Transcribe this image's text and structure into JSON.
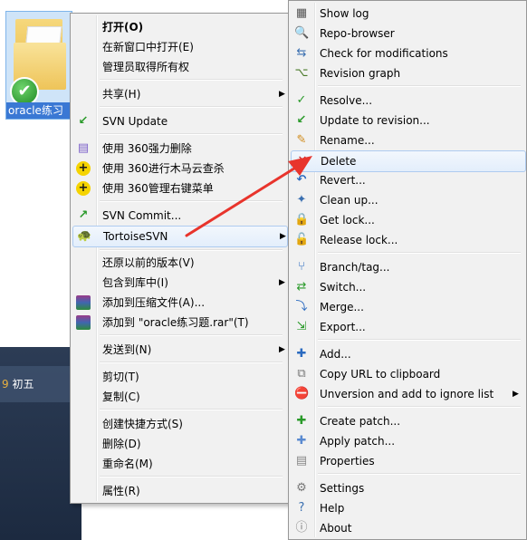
{
  "desktop": {
    "folder_label": "oracle练习",
    "date_num": "9",
    "date_text": "初五"
  },
  "menu1": {
    "open": "打开(O)",
    "open_new_window": "在新窗口中打开(E)",
    "take_ownership": "管理员取得所有权",
    "share": "共享(H)",
    "svn_update": "SVN Update",
    "delete_360": "使用 360强力删除",
    "scan_360": "使用 360进行木马云查杀",
    "manage_360": "使用 360管理右键菜单",
    "svn_commit": "SVN Commit...",
    "tortoise": "TortoiseSVN",
    "restore": "还原以前的版本(V)",
    "include_lib": "包含到库中(I)",
    "add_archive": "添加到压缩文件(A)...",
    "add_rar": "添加到 \"oracle练习题.rar\"(T)",
    "send_to": "发送到(N)",
    "cut": "剪切(T)",
    "copy": "复制(C)",
    "shortcut": "创建快捷方式(S)",
    "delete": "删除(D)",
    "rename": "重命名(M)",
    "properties": "属性(R)"
  },
  "menu2": {
    "show_log": "Show log",
    "repo_browser": "Repo-browser",
    "check_mod": "Check for modifications",
    "rev_graph": "Revision graph",
    "resolve": "Resolve...",
    "update_rev": "Update to revision...",
    "rename": "Rename...",
    "delete": "Delete",
    "revert": "Revert...",
    "clean_up": "Clean up...",
    "get_lock": "Get lock...",
    "release_lock": "Release lock...",
    "branch_tag": "Branch/tag...",
    "switch": "Switch...",
    "merge": "Merge...",
    "export": "Export...",
    "add": "Add...",
    "copy_url": "Copy URL to clipboard",
    "unversion": "Unversion and add to ignore list",
    "create_patch": "Create patch...",
    "apply_patch": "Apply patch...",
    "properties": "Properties",
    "settings": "Settings",
    "help": "Help",
    "about": "About"
  },
  "colors": {
    "annotation_arrow": "#e8342c",
    "highlight_border": "#aecbf0"
  }
}
